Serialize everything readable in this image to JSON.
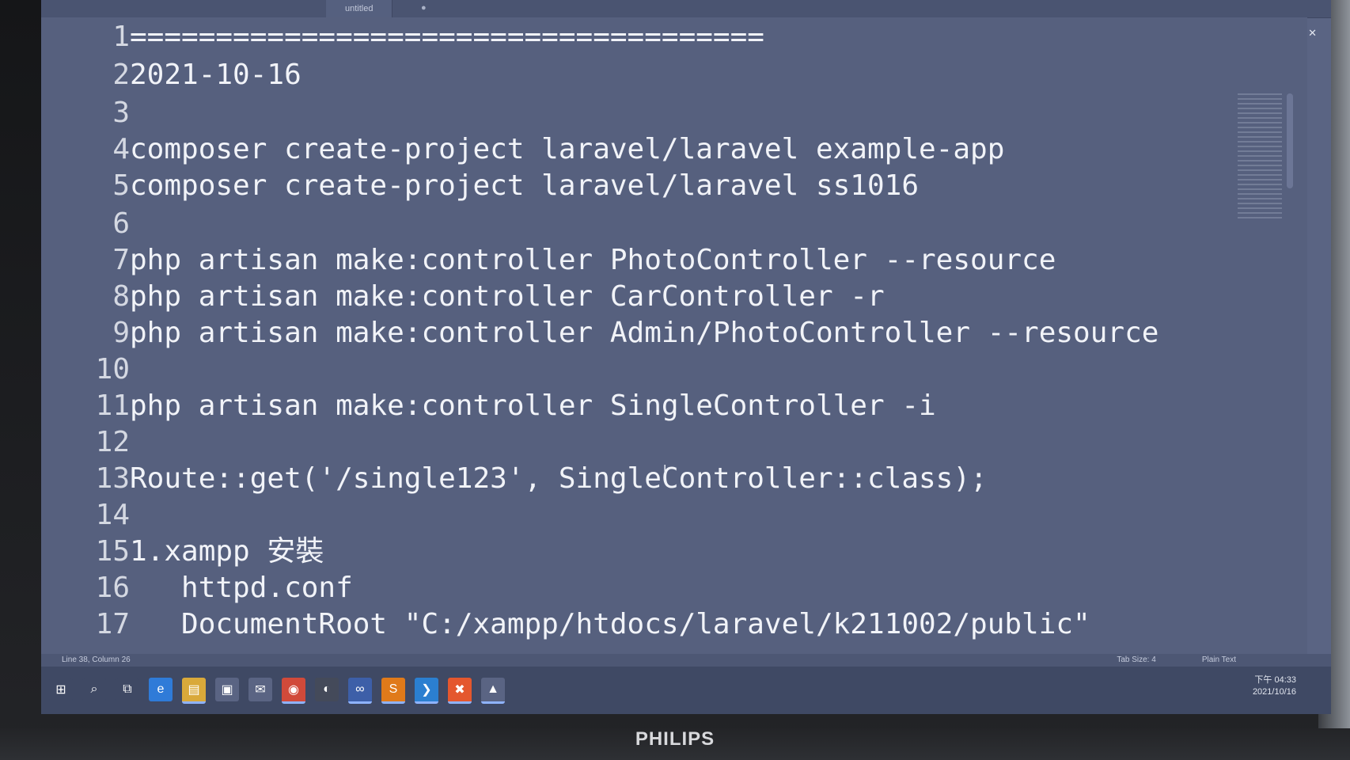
{
  "window": {
    "tab_label": "untitled",
    "tab_close": "●",
    "controls": {
      "minimize": "–",
      "maximize": "□",
      "close": "✕"
    }
  },
  "editor": {
    "lines": [
      {
        "num": "1",
        "text": "====================================="
      },
      {
        "num": "2",
        "text": "2021-10-16"
      },
      {
        "num": "3",
        "text": ""
      },
      {
        "num": "4",
        "text": "composer create-project laravel/laravel example-app"
      },
      {
        "num": "5",
        "text": "composer create-project laravel/laravel ss1016"
      },
      {
        "num": "6",
        "text": ""
      },
      {
        "num": "7",
        "text": "php artisan make:controller PhotoController --resource"
      },
      {
        "num": "8",
        "text": "php artisan make:controller CarController -r"
      },
      {
        "num": "9",
        "text": "php artisan make:controller Admin/PhotoController --resource"
      },
      {
        "num": "10",
        "text": ""
      },
      {
        "num": "11",
        "text": "php artisan make:controller SingleController -i"
      },
      {
        "num": "12",
        "text": ""
      },
      {
        "num": "13",
        "text": "Route::get('/single123', SingleController::class);"
      },
      {
        "num": "14",
        "text": ""
      },
      {
        "num": "15",
        "text": "1.xampp 安裝"
      },
      {
        "num": "16",
        "text": "   httpd.conf"
      },
      {
        "num": "17",
        "text": "   DocumentRoot \"C:/xampp/htdocs/laravel/k211002/public\""
      }
    ]
  },
  "statusbar": {
    "position": "Line 38, Column 26",
    "tab_size": "Tab Size: 4",
    "syntax": "Plain Text"
  },
  "taskbar": {
    "icons": [
      "windows-start-icon",
      "search-icon",
      "task-view-icon",
      "edge-icon",
      "file-explorer-icon",
      "store-icon",
      "mail-icon",
      "chrome-icon",
      "app-icon",
      "app-icon-2",
      "sublime-text-icon",
      "vscode-icon",
      "xampp-icon",
      "photos-icon"
    ],
    "time": "下午 04:33",
    "date": "2021/10/16"
  },
  "monitor": {
    "brand": "PHILIPS"
  },
  "colors": {
    "editor_bg": "#56607e",
    "text": "#f1f3f8",
    "gutter": "#d4d8e2"
  }
}
